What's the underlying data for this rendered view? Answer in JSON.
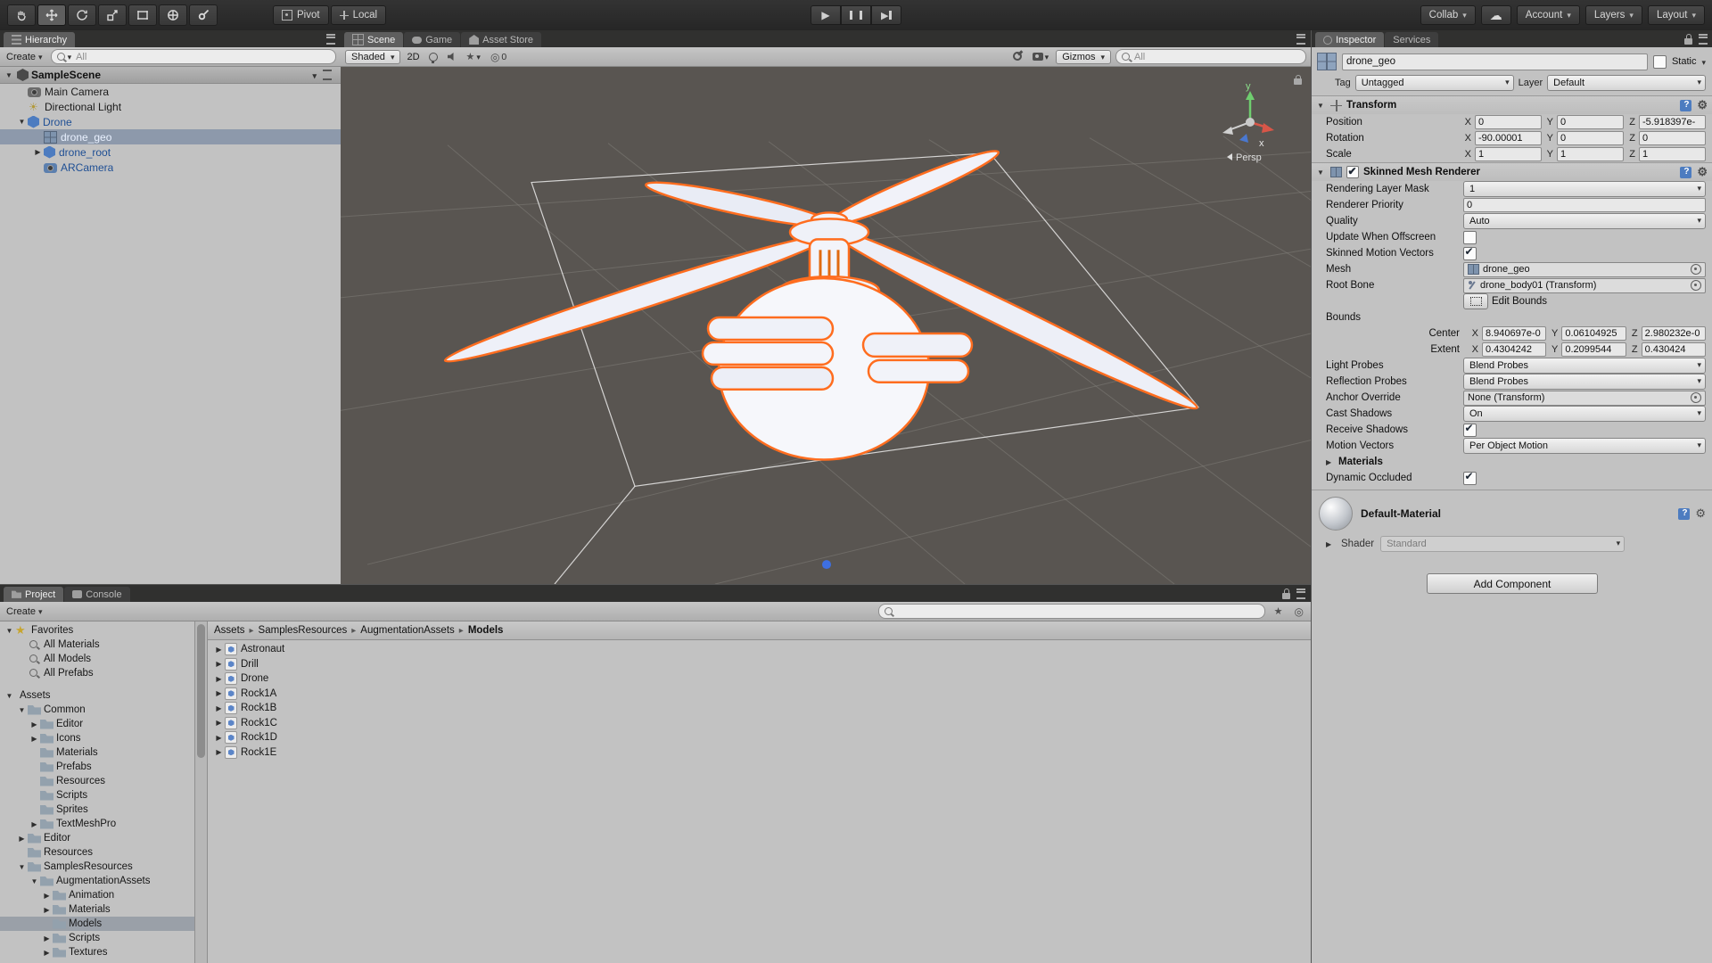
{
  "toolbar": {
    "pivot": "Pivot",
    "local": "Local",
    "collab": "Collab",
    "account": "Account",
    "layers": "Layers",
    "layout": "Layout",
    "tools": {
      "hand": false,
      "move": true,
      "rotate": false,
      "scale": false,
      "rect": false,
      "transform": false,
      "custom": false
    }
  },
  "tabs": {
    "hierarchy": "Hierarchy",
    "scene": "Scene",
    "game": "Game",
    "asset_store": "Asset Store",
    "project": "Project",
    "console": "Console",
    "inspector": "Inspector",
    "services": "Services"
  },
  "hierarchy": {
    "create": "Create",
    "search_placeholder": "All",
    "scene_name": "SampleScene",
    "items": [
      {
        "label": "Main Camera",
        "indent": 1,
        "icon": "camera",
        "cls": "normal",
        "arrow": "none"
      },
      {
        "label": "Directional Light",
        "indent": 1,
        "icon": "light",
        "cls": "normal",
        "arrow": "none"
      },
      {
        "label": "Drone",
        "indent": 1,
        "icon": "prefab",
        "cls": "prefab",
        "arrow": "expanded"
      },
      {
        "label": "drone_geo",
        "indent": 2,
        "icon": "mesh",
        "cls": "prefab selected",
        "arrow": "none"
      },
      {
        "label": "drone_root",
        "indent": 2,
        "icon": "prefab",
        "cls": "prefab",
        "arrow": "collapsed"
      },
      {
        "label": "ARCamera",
        "indent": 2,
        "icon": "camera-blue",
        "cls": "prefab",
        "arrow": "none"
      }
    ]
  },
  "scene": {
    "shading_mode": "Shaded",
    "toggle_2d": "2D",
    "visibility_count": "0",
    "gizmos": "Gizmos",
    "search_placeholder": "All",
    "axis_y": "y",
    "axis_x": "x",
    "persp": "Persp"
  },
  "project": {
    "create": "Create",
    "search_placeholder": "",
    "breadcrumb": [
      {
        "label": "Assets"
      },
      {
        "label": "SamplesResources"
      },
      {
        "label": "AugmentationAssets"
      },
      {
        "label": "Models",
        "current": true
      }
    ],
    "tree": [
      {
        "label": "Favorites",
        "indent": 0,
        "icon": "star",
        "arrow": "expanded",
        "cls": "normal"
      },
      {
        "label": "All Materials",
        "indent": 1,
        "icon": "search",
        "arrow": "none",
        "cls": "normal"
      },
      {
        "label": "All Models",
        "indent": 1,
        "icon": "search",
        "arrow": "none",
        "cls": "normal"
      },
      {
        "label": "All Prefabs",
        "indent": 1,
        "icon": "search",
        "arrow": "none",
        "cls": "normal"
      },
      {
        "label": "Assets",
        "indent": 0,
        "icon": "none",
        "arrow": "expanded",
        "cls": "normal",
        "spacer": true
      },
      {
        "label": "Common",
        "indent": 1,
        "icon": "folder",
        "arrow": "expanded",
        "cls": "normal"
      },
      {
        "label": "Editor",
        "indent": 2,
        "icon": "folder",
        "arrow": "collapsed",
        "cls": "normal"
      },
      {
        "label": "Icons",
        "indent": 2,
        "icon": "folder",
        "arrow": "collapsed",
        "cls": "normal"
      },
      {
        "label": "Materials",
        "indent": 2,
        "icon": "folder",
        "arrow": "none",
        "cls": "normal"
      },
      {
        "label": "Prefabs",
        "indent": 2,
        "icon": "folder",
        "arrow": "none",
        "cls": "normal"
      },
      {
        "label": "Resources",
        "indent": 2,
        "icon": "folder",
        "arrow": "none",
        "cls": "normal"
      },
      {
        "label": "Scripts",
        "indent": 2,
        "icon": "folder",
        "arrow": "none",
        "cls": "normal"
      },
      {
        "label": "Sprites",
        "indent": 2,
        "icon": "folder",
        "arrow": "none",
        "cls": "normal"
      },
      {
        "label": "TextMeshPro",
        "indent": 2,
        "icon": "folder",
        "arrow": "collapsed",
        "cls": "normal"
      },
      {
        "label": "Editor",
        "indent": 1,
        "icon": "folder",
        "arrow": "collapsed",
        "cls": "normal"
      },
      {
        "label": "Resources",
        "indent": 1,
        "icon": "folder",
        "arrow": "none",
        "cls": "normal"
      },
      {
        "label": "SamplesResources",
        "indent": 1,
        "icon": "folder",
        "arrow": "expanded",
        "cls": "normal"
      },
      {
        "label": "AugmentationAssets",
        "indent": 2,
        "icon": "folder",
        "arrow": "expanded",
        "cls": "normal"
      },
      {
        "label": "Animation",
        "indent": 3,
        "icon": "folder",
        "arrow": "collapsed",
        "cls": "normal"
      },
      {
        "label": "Materials",
        "indent": 3,
        "icon": "folder",
        "arrow": "collapsed",
        "cls": "normal"
      },
      {
        "label": "Models",
        "indent": 3,
        "icon": "folder",
        "arrow": "none",
        "cls": "selected"
      },
      {
        "label": "Scripts",
        "indent": 3,
        "icon": "folder",
        "arrow": "collapsed",
        "cls": "normal"
      },
      {
        "label": "Textures",
        "indent": 3,
        "icon": "folder",
        "arrow": "collapsed",
        "cls": "normal"
      }
    ],
    "items": [
      {
        "label": "Astronaut"
      },
      {
        "label": "Drill"
      },
      {
        "label": "Drone"
      },
      {
        "label": "Rock1A"
      },
      {
        "label": "Rock1B"
      },
      {
        "label": "Rock1C"
      },
      {
        "label": "Rock1D"
      },
      {
        "label": "Rock1E"
      }
    ]
  },
  "inspector": {
    "name": "drone_geo",
    "static_label": "Static",
    "tag_label": "Tag",
    "tag": "Untagged",
    "layer_label": "Layer",
    "layer": "Default",
    "axis": {
      "x": "X",
      "y": "Y",
      "z": "Z"
    },
    "transform": {
      "title": "Transform",
      "rows": [
        {
          "label": "Position",
          "x": "0",
          "y": "0",
          "z": "-5.918397e-"
        },
        {
          "label": "Rotation",
          "x": "-90.00001",
          "y": "0",
          "z": "0"
        },
        {
          "label": "Scale",
          "x": "1",
          "y": "1",
          "z": "1"
        }
      ]
    },
    "smr": {
      "title": "Skinned Mesh Renderer",
      "enabled": true,
      "rendering_layer_mask_label": "Rendering Layer Mask",
      "rendering_layer_mask": "1",
      "renderer_priority_label": "Renderer Priority",
      "renderer_priority": "0",
      "quality_label": "Quality",
      "quality": "Auto",
      "update_when_offscreen_label": "Update When Offscreen",
      "update_when_offscreen": false,
      "skinned_motion_vectors_label": "Skinned Motion Vectors",
      "skinned_motion_vectors": true,
      "mesh_label": "Mesh",
      "mesh": "drone_geo",
      "root_bone_label": "Root Bone",
      "root_bone": "drone_body01 (Transform)",
      "edit_bounds_label": "Edit Bounds",
      "bounds_label": "Bounds",
      "center_label": "Center",
      "center": {
        "x": "8.940697e-0",
        "y": "0.06104925",
        "z": "2.980232e-0"
      },
      "extent_label": "Extent",
      "extent": {
        "x": "0.4304242",
        "y": "0.2099544",
        "z": "0.430424"
      },
      "light_probes_label": "Light Probes",
      "light_probes": "Blend Probes",
      "reflection_probes_label": "Reflection Probes",
      "reflection_probes": "Blend Probes",
      "anchor_override_label": "Anchor Override",
      "anchor_override": "None (Transform)",
      "cast_shadows_label": "Cast Shadows",
      "cast_shadows": "On",
      "receive_shadows_label": "Receive Shadows",
      "receive_shadows": true,
      "motion_vectors_label": "Motion Vectors",
      "motion_vectors": "Per Object Motion",
      "materials_label": "Materials",
      "dynamic_occluded_label": "Dynamic Occluded",
      "dynamic_occluded": true
    },
    "material": {
      "name": "Default-Material",
      "shader_label": "Shader",
      "shader": "Standard"
    },
    "add_component": "Add Component"
  }
}
